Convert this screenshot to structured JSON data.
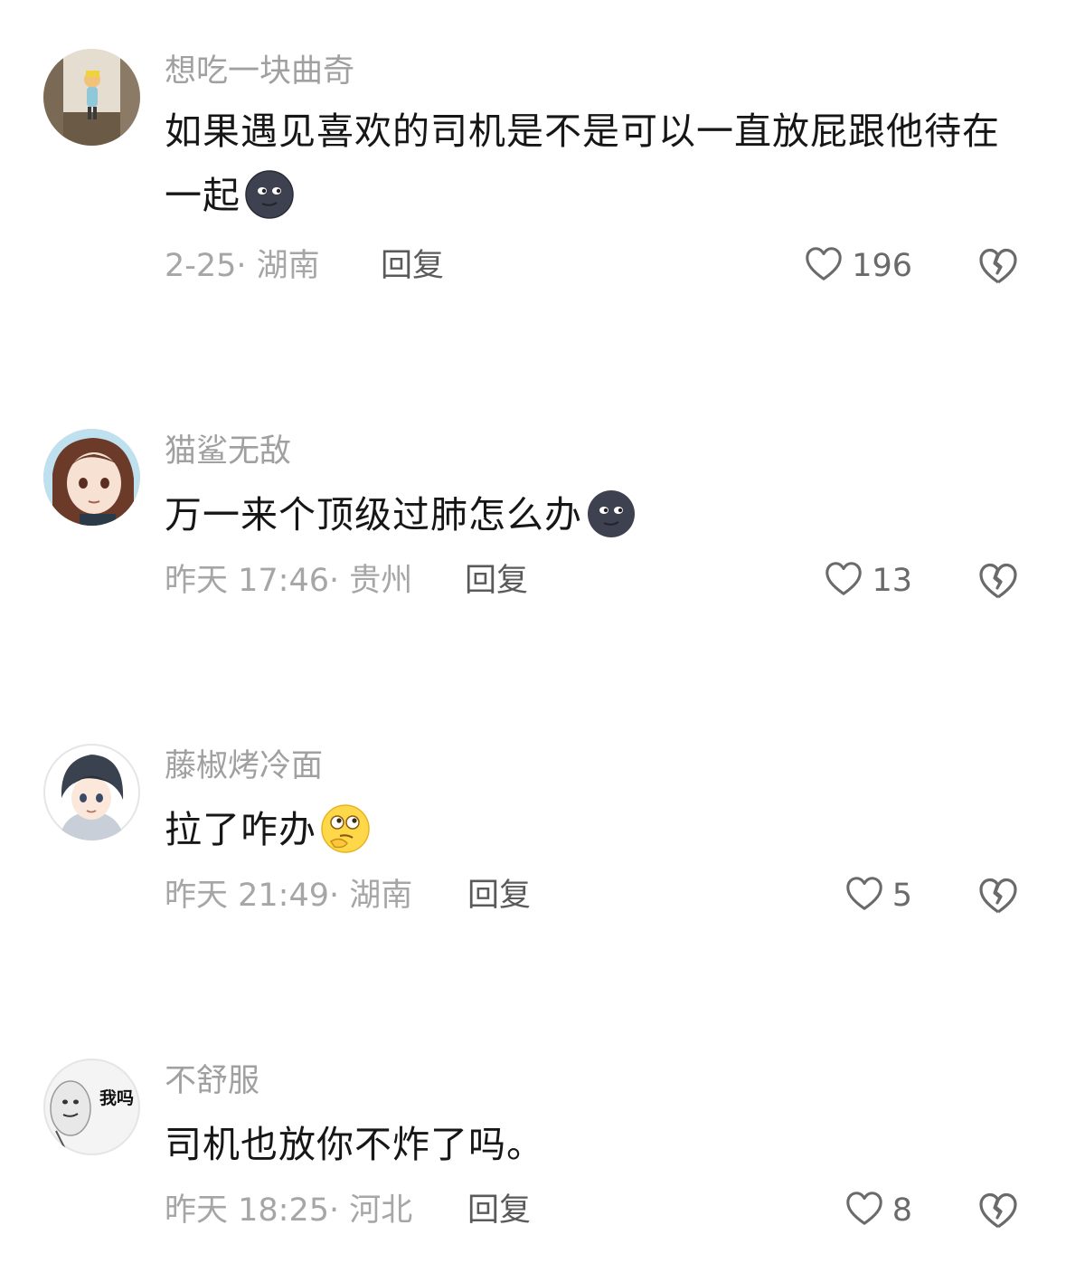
{
  "comments": [
    {
      "username": "想吃一块曲奇",
      "text": "如果遇见喜欢的司机是不是可以一直放屁跟他待在一起",
      "emoji": "new-moon-face",
      "meta": "2-25· 湖南",
      "reply_label": "回复",
      "likes": "196"
    },
    {
      "username": "猫鲨无敌",
      "text": "万一来个顶级过肺怎么办",
      "emoji": "new-moon-face",
      "meta": "昨天 17:46· 贵州",
      "reply_label": "回复",
      "likes": "13"
    },
    {
      "username": "藤椒烤冷面",
      "text": "拉了咋办",
      "emoji": "thinking-face",
      "meta": "昨天 21:49· 湖南",
      "reply_label": "回复",
      "likes": "5"
    },
    {
      "username": "不舒服",
      "text": "司机也放你不炸了吗。",
      "emoji": "",
      "avatar_text": "我吗",
      "meta": "昨天 18:25· 河北",
      "reply_label": "回复",
      "likes": "8"
    }
  ],
  "icons": {
    "like": "heart-outline-icon",
    "dislike": "broken-heart-icon"
  },
  "colors": {
    "username": "#a0a0a0",
    "text": "#161616",
    "meta": "#a6a6a6",
    "reply": "#5a5a5a"
  }
}
